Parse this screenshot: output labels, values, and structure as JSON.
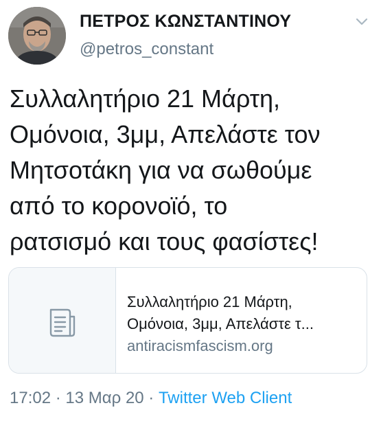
{
  "author": {
    "display_name": "ΠΕΤΡΟΣ ΚΩΝΣΤΑΝΤΙΝΟΥ",
    "handle": "@petros_constant",
    "avatar_icon": "person-photo-avatar"
  },
  "tweet": {
    "text_lines": [
      "Συλλαλητήριο 21 Μάρτη,",
      "Ομόνοια, 3μμ, Απελάστε τον",
      "Μητσοτάκη για να σωθούμε",
      "από το κορονοϊό, το",
      "ρατσισμό και τους φασίστες!"
    ]
  },
  "card": {
    "icon": "document-icon",
    "title_lines": [
      "Συλλαλητήριο 21 Μάρτη,",
      "Ομόνοια, 3μμ, Απελάστε τ..."
    ],
    "domain": "antiracismfascism.org"
  },
  "meta": {
    "time": "17:02",
    "separator": " · ",
    "date": "13 Μαρ 20",
    "source": "Twitter Web Client"
  },
  "colors": {
    "text": "#14171a",
    "secondary": "#657786",
    "link": "#1da1f2",
    "border": "#d9e1e8"
  }
}
